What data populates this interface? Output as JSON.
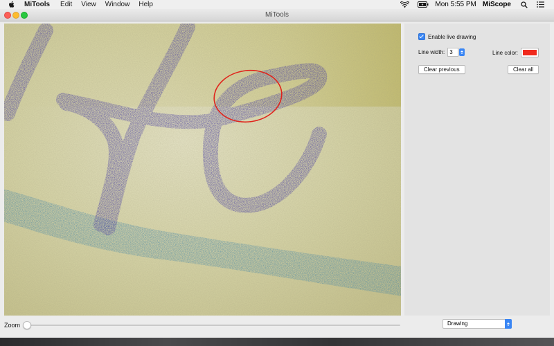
{
  "menubar": {
    "app_name": "MiTools",
    "items": [
      "Edit",
      "View",
      "Window",
      "Help"
    ],
    "clock": "Mon 5:55 PM",
    "active_app": "MiScope"
  },
  "window": {
    "title": "MiTools"
  },
  "camera": {
    "annotation_color": "#e0231b",
    "ink_color": "#3a2fa0",
    "marker_color": "#2f7aa8"
  },
  "panel": {
    "live_drawing_label": "Enable live drawing",
    "live_drawing_checked": true,
    "line_width_label": "Line width:",
    "line_width_value": "3",
    "line_color_label": "Line color:",
    "line_color_value": "#f0291c",
    "clear_previous_label": "Clear previous",
    "clear_all_label": "Clear all"
  },
  "bottom": {
    "zoom_label": "Zoom",
    "zoom_level": 0,
    "mode_value": "Drawing"
  },
  "colors": {
    "accent": "#3a86f4"
  }
}
